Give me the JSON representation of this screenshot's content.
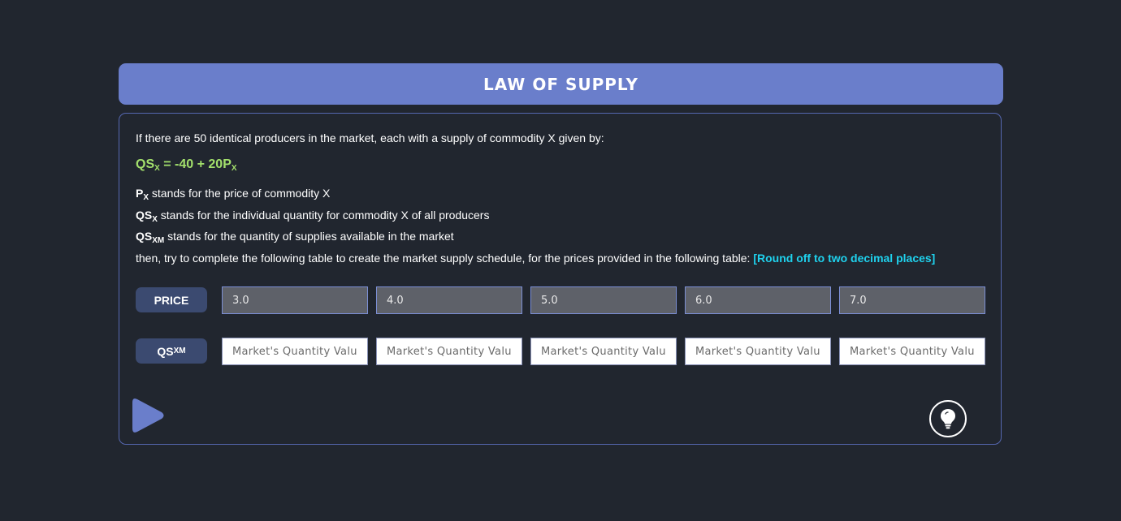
{
  "header": {
    "title": "LAW OF SUPPLY"
  },
  "question": {
    "intro": "If there are 50 identical producers in the market, each with a supply of commodity X given by:",
    "equation": {
      "lhs": "QS",
      "lhs_sub": "X",
      "rhs": " = -40 + 20P",
      "rhs_sub": "X"
    },
    "definitions": [
      {
        "sym": "P",
        "sub": "X",
        "text": " stands for the price of commodity X"
      },
      {
        "sym": "QS",
        "sub": "X",
        "text": " stands for the individual quantity for commodity X of all producers"
      },
      {
        "sym": "QS",
        "sub": "XM",
        "text": " stands for the quantity of supplies available in the market"
      }
    ],
    "instruction": "then, try to complete the following table to create the market supply schedule, for the prices provided in the following table: ",
    "note": "[Round off to two decimal places]"
  },
  "table": {
    "price_label": "PRICE",
    "qty_label": {
      "main": "QS",
      "sub": "XM"
    },
    "prices": [
      "3.0",
      "4.0",
      "5.0",
      "6.0",
      "7.0"
    ],
    "qty_placeholder": "Market's Quantity Value"
  },
  "icons": {
    "play": "play-icon",
    "hint": "lightbulb-icon"
  },
  "colors": {
    "background": "#21262f",
    "header": "#6a7ecb",
    "equation": "#a3e06c",
    "note": "#1fd2ee",
    "label": "#3b4a70"
  }
}
